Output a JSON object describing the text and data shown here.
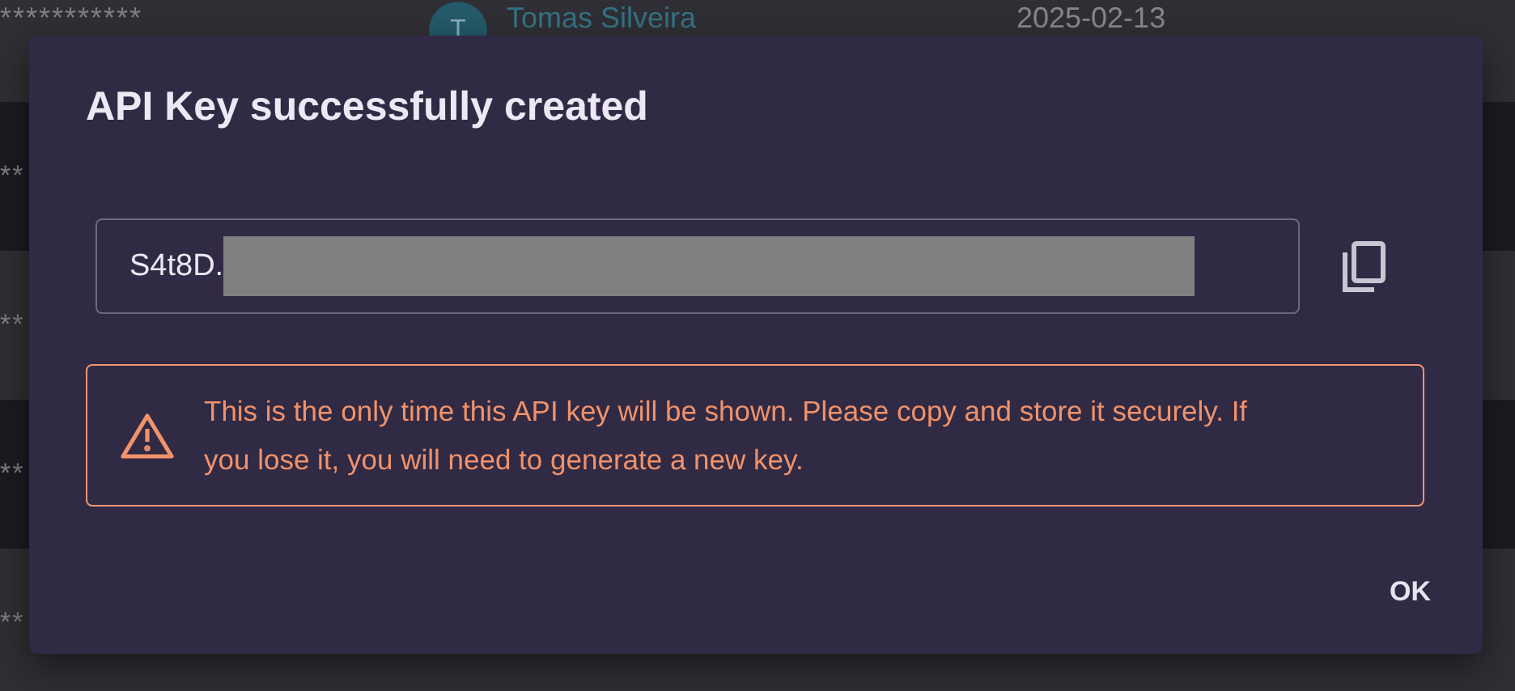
{
  "background_table": {
    "rows": [
      {
        "key": "***********",
        "avatar": "T",
        "name": "Tomas Silveira",
        "date": "2025-02-13"
      },
      {
        "key": "**"
      },
      {
        "key": "**"
      },
      {
        "key": "**"
      },
      {
        "key": "**"
      }
    ]
  },
  "dialog": {
    "title": "API Key successfully created",
    "key_field": {
      "value": "S4t8D.",
      "redacted": true
    },
    "warning": "This is the only time this API key will be shown. Please copy and store it securely. If you lose it, you will need to generate a new key.",
    "buttons": [
      "OK"
    ]
  }
}
